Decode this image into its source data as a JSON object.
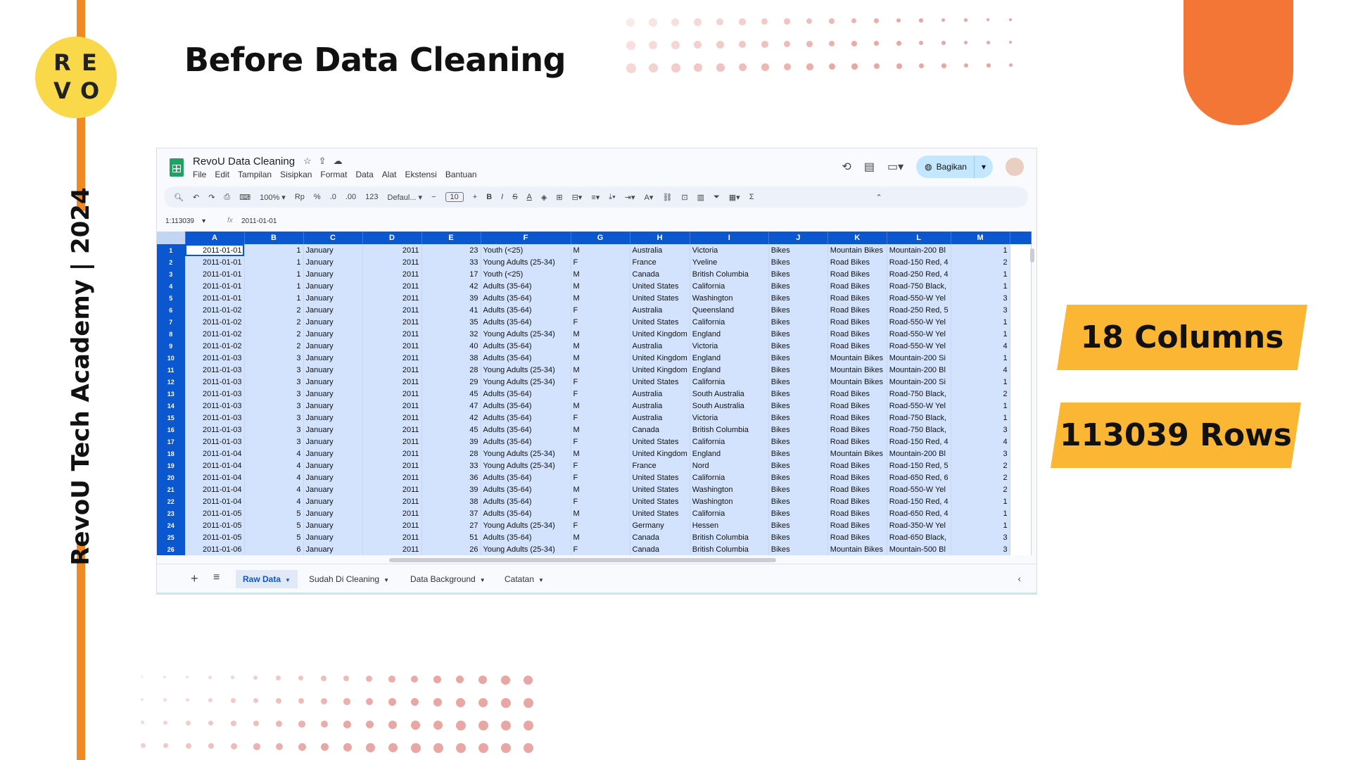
{
  "slide": {
    "title": "Before Data Cleaning",
    "side_text": "RevoU Tech Academy | 2024",
    "logo_letters": [
      "R",
      "E",
      "V",
      "O"
    ],
    "badges": [
      "18 Columns",
      "113039 Rows"
    ],
    "colors": {
      "accent_orange": "#f08a24",
      "pill_orange": "#f47636",
      "badge_yellow": "#fbb633",
      "logo_yellow": "#f9d84a"
    }
  },
  "sheet": {
    "doc_title": "RevoU Data Cleaning",
    "menu": [
      "File",
      "Edit",
      "Tampilan",
      "Sisipkan",
      "Format",
      "Data",
      "Alat",
      "Ekstensi",
      "Bantuan"
    ],
    "share_label": "Bagikan",
    "toolbar": {
      "zoom": "100%",
      "currency": "Rp",
      "percent": "%",
      "dec_less": ".0",
      "dec_more": ".00",
      "format_num": "123",
      "font": "Defaul...",
      "font_size": "10"
    },
    "name_box": "1:113039",
    "formula_value": "2011-01-01",
    "columns": [
      "A",
      "B",
      "C",
      "D",
      "E",
      "F",
      "G",
      "H",
      "I",
      "J",
      "K",
      "L",
      "M"
    ],
    "rows": [
      [
        "1",
        "2011-01-01",
        "1",
        "January",
        "2011",
        "23",
        "Youth (<25)",
        "M",
        "Australia",
        "Victoria",
        "Bikes",
        "Mountain Bikes",
        "Mountain-200 Bl",
        "1"
      ],
      [
        "2",
        "2011-01-01",
        "1",
        "January",
        "2011",
        "33",
        "Young Adults (25-34)",
        "F",
        "France",
        "Yveline",
        "Bikes",
        "Road Bikes",
        "Road-150 Red, 4",
        "2"
      ],
      [
        "3",
        "2011-01-01",
        "1",
        "January",
        "2011",
        "17",
        "Youth (<25)",
        "M",
        "Canada",
        "British Columbia",
        "Bikes",
        "Road Bikes",
        "Road-250 Red, 4",
        "1"
      ],
      [
        "4",
        "2011-01-01",
        "1",
        "January",
        "2011",
        "42",
        "Adults (35-64)",
        "M",
        "United States",
        "California",
        "Bikes",
        "Road Bikes",
        "Road-750 Black,",
        "1"
      ],
      [
        "5",
        "2011-01-01",
        "1",
        "January",
        "2011",
        "39",
        "Adults (35-64)",
        "M",
        "United States",
        "Washington",
        "Bikes",
        "Road Bikes",
        "Road-550-W Yel",
        "3"
      ],
      [
        "6",
        "2011-01-02",
        "2",
        "January",
        "2011",
        "41",
        "Adults (35-64)",
        "F",
        "Australia",
        "Queensland",
        "Bikes",
        "Road Bikes",
        "Road-250 Red, 5",
        "3"
      ],
      [
        "7",
        "2011-01-02",
        "2",
        "January",
        "2011",
        "35",
        "Adults (35-64)",
        "F",
        "United States",
        "California",
        "Bikes",
        "Road Bikes",
        "Road-550-W Yel",
        "1"
      ],
      [
        "8",
        "2011-01-02",
        "2",
        "January",
        "2011",
        "32",
        "Young Adults (25-34)",
        "M",
        "United Kingdom",
        "England",
        "Bikes",
        "Road Bikes",
        "Road-550-W Yel",
        "1"
      ],
      [
        "9",
        "2011-01-02",
        "2",
        "January",
        "2011",
        "40",
        "Adults (35-64)",
        "M",
        "Australia",
        "Victoria",
        "Bikes",
        "Road Bikes",
        "Road-550-W Yel",
        "4"
      ],
      [
        "10",
        "2011-01-03",
        "3",
        "January",
        "2011",
        "38",
        "Adults (35-64)",
        "M",
        "United Kingdom",
        "England",
        "Bikes",
        "Mountain Bikes",
        "Mountain-200 Si",
        "1"
      ],
      [
        "11",
        "2011-01-03",
        "3",
        "January",
        "2011",
        "28",
        "Young Adults (25-34)",
        "M",
        "United Kingdom",
        "England",
        "Bikes",
        "Mountain Bikes",
        "Mountain-200 Bl",
        "4"
      ],
      [
        "12",
        "2011-01-03",
        "3",
        "January",
        "2011",
        "29",
        "Young Adults (25-34)",
        "F",
        "United States",
        "California",
        "Bikes",
        "Mountain Bikes",
        "Mountain-200 Si",
        "1"
      ],
      [
        "13",
        "2011-01-03",
        "3",
        "January",
        "2011",
        "45",
        "Adults (35-64)",
        "F",
        "Australia",
        "South Australia",
        "Bikes",
        "Road Bikes",
        "Road-750 Black,",
        "2"
      ],
      [
        "14",
        "2011-01-03",
        "3",
        "January",
        "2011",
        "47",
        "Adults (35-64)",
        "M",
        "Australia",
        "South Australia",
        "Bikes",
        "Road Bikes",
        "Road-550-W Yel",
        "1"
      ],
      [
        "15",
        "2011-01-03",
        "3",
        "January",
        "2011",
        "42",
        "Adults (35-64)",
        "F",
        "Australia",
        "Victoria",
        "Bikes",
        "Road Bikes",
        "Road-750 Black,",
        "1"
      ],
      [
        "16",
        "2011-01-03",
        "3",
        "January",
        "2011",
        "45",
        "Adults (35-64)",
        "M",
        "Canada",
        "British Columbia",
        "Bikes",
        "Road Bikes",
        "Road-750 Black,",
        "3"
      ],
      [
        "17",
        "2011-01-03",
        "3",
        "January",
        "2011",
        "39",
        "Adults (35-64)",
        "F",
        "United States",
        "California",
        "Bikes",
        "Road Bikes",
        "Road-150 Red, 4",
        "4"
      ],
      [
        "18",
        "2011-01-04",
        "4",
        "January",
        "2011",
        "28",
        "Young Adults (25-34)",
        "M",
        "United Kingdom",
        "England",
        "Bikes",
        "Mountain Bikes",
        "Mountain-200 Bl",
        "3"
      ],
      [
        "19",
        "2011-01-04",
        "4",
        "January",
        "2011",
        "33",
        "Young Adults (25-34)",
        "F",
        "France",
        "Nord",
        "Bikes",
        "Road Bikes",
        "Road-150 Red, 5",
        "2"
      ],
      [
        "20",
        "2011-01-04",
        "4",
        "January",
        "2011",
        "36",
        "Adults (35-64)",
        "F",
        "United States",
        "California",
        "Bikes",
        "Road Bikes",
        "Road-650 Red, 6",
        "2"
      ],
      [
        "21",
        "2011-01-04",
        "4",
        "January",
        "2011",
        "39",
        "Adults (35-64)",
        "M",
        "United States",
        "Washington",
        "Bikes",
        "Road Bikes",
        "Road-550-W Yel",
        "2"
      ],
      [
        "22",
        "2011-01-04",
        "4",
        "January",
        "2011",
        "38",
        "Adults (35-64)",
        "F",
        "United States",
        "Washington",
        "Bikes",
        "Road Bikes",
        "Road-150 Red, 4",
        "1"
      ],
      [
        "23",
        "2011-01-05",
        "5",
        "January",
        "2011",
        "37",
        "Adults (35-64)",
        "M",
        "United States",
        "California",
        "Bikes",
        "Road Bikes",
        "Road-650 Red, 4",
        "1"
      ],
      [
        "24",
        "2011-01-05",
        "5",
        "January",
        "2011",
        "27",
        "Young Adults (25-34)",
        "F",
        "Germany",
        "Hessen",
        "Bikes",
        "Road Bikes",
        "Road-350-W Yel",
        "1"
      ],
      [
        "25",
        "2011-01-05",
        "5",
        "January",
        "2011",
        "51",
        "Adults (35-64)",
        "M",
        "Canada",
        "British Columbia",
        "Bikes",
        "Road Bikes",
        "Road-650 Black,",
        "3"
      ],
      [
        "26",
        "2011-01-06",
        "6",
        "January",
        "2011",
        "26",
        "Young Adults (25-34)",
        "F",
        "Canada",
        "British Columbia",
        "Bikes",
        "Mountain Bikes",
        "Mountain-500 Bl",
        "3"
      ]
    ],
    "tabs": [
      "Raw Data",
      "Sudah Di Cleaning",
      "Data Background",
      "Catatan"
    ],
    "active_tab": "Raw Data",
    "icons": [
      "star-icon",
      "move-icon",
      "cloud-icon",
      "history-icon",
      "comment-icon",
      "video-icon",
      "globe-icon",
      "search-icon",
      "undo-icon",
      "redo-icon",
      "print-icon",
      "paint-format-icon",
      "bold-icon",
      "italic-icon",
      "strikethrough-icon",
      "text-color-icon",
      "fill-color-icon",
      "borders-icon",
      "merge-icon",
      "align-icon",
      "valign-icon",
      "wrap-icon",
      "rotate-icon",
      "link-icon",
      "comment-add-icon",
      "chart-icon",
      "filter-icon",
      "table-view-icon",
      "sigma-icon",
      "collapse-icon",
      "add-sheet-icon",
      "all-sheets-icon",
      "dropdown-icon",
      "nav-left-icon"
    ]
  }
}
